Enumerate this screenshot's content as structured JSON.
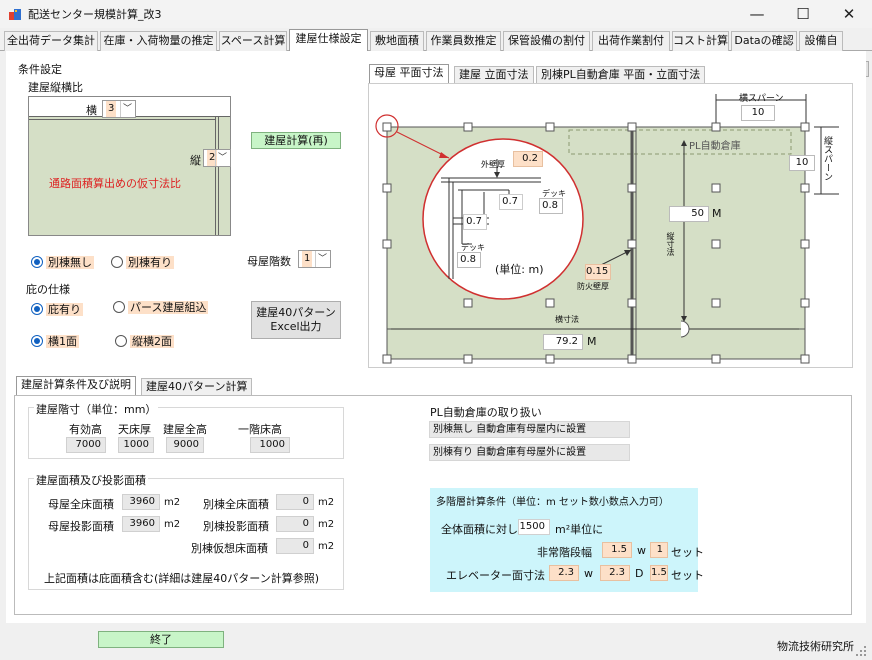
{
  "window": {
    "title": "配送センター規模計算_改3",
    "minimize": "—",
    "maximize": "☐",
    "close": "✕"
  },
  "main_tabs": [
    "全出荷データ集計",
    "在庫・入荷物量の推定",
    "スペース計算",
    "建屋仕様設定",
    "敷地面積",
    "作業員数推定",
    "保管設備の割付",
    "出荷作業割付",
    "コスト計算",
    "Dataの確認",
    "設備自"
  ],
  "main_tab_scroll": {
    "left": "◂",
    "right": "▸"
  },
  "conditions": {
    "title": "条件設定",
    "aspect_label": "建屋縦横比",
    "yoko_label": "横",
    "yoko_value": "3",
    "tate_label": "縦",
    "tate_value": "2",
    "placeholder_text": "通路面積算出めの仮寸法比",
    "calc_button": "建屋計算(再)",
    "radio_betsumune_none": "別棟無し",
    "radio_betsumune_yes": "別棟有り",
    "floors_label": "母屋階数",
    "floors_value": "1",
    "eave_title": "庇の仕様",
    "radio_eave_yes": "庇有り",
    "radio_perth": "パース建屋組込",
    "radio_side1": "横1面",
    "radio_side2": "縦横2面",
    "excel_button_line1": "建屋40パターン",
    "excel_button_line2": "Excel出力"
  },
  "drawing_tabs": [
    "母屋 平面寸法",
    "建屋 立面寸法",
    "別棟PL自動倉庫 平面・立面寸法"
  ],
  "drawing": {
    "yoko_span_label": "横スパーン",
    "yoko_span_value": "10",
    "tate_span_label": "縦スパーン",
    "tate_span_value": "10",
    "pl_label": "PL自動倉庫",
    "tate_sun_label": "縦寸法",
    "tate_sun_value": "50",
    "yoko_sun_label": "横寸法",
    "yoko_sun_value": "79.2",
    "unit_m": "M",
    "outer_wall_label": "外壁厚",
    "outer_wall_value": "0.2",
    "deck_label": "デッキ",
    "deck_value_1": "0.8",
    "dim_07a": "0.7",
    "dim_07b": "0.7",
    "deck_value_2": "0.8",
    "unit_note": "(単位: m)",
    "fire_wall_value": "0.15",
    "fire_wall_label": "防火壁厚"
  },
  "bottom_tabs": [
    "建屋計算条件及び説明",
    "建屋40パターン計算"
  ],
  "height": {
    "title": "建屋階寸（単位：mm）",
    "headers": [
      "有効高",
      "天床厚",
      "建屋全高",
      "一階床高"
    ],
    "values": [
      "7000",
      "1000",
      "9000",
      "1000"
    ]
  },
  "area": {
    "title": "建屋面積及び投影面積",
    "rows": [
      {
        "label": "母屋全床面積",
        "value": "3960",
        "unit": "m2"
      },
      {
        "label": "母屋投影面積",
        "value": "3960",
        "unit": "m2"
      }
    ],
    "right_rows": [
      {
        "label": "別棟全床面積",
        "value": "0",
        "unit": "m2"
      },
      {
        "label": "別棟投影面積",
        "value": "0",
        "unit": "m2"
      },
      {
        "label": "別棟仮想床面積",
        "value": "0",
        "unit": "m2"
      }
    ],
    "note": "上記面積は庇面積含む(詳細は建屋40パターン計算参照)"
  },
  "pl": {
    "title": "PL自動倉庫の取り扱い",
    "line1": "別棟無し 自動倉庫有母屋内に設置",
    "line2": "別棟有り 自動倉庫有母屋外に設置"
  },
  "multi": {
    "title": "多階層計算条件（単位：m セット数小数点入力可）",
    "area_prefix": "全体面積に対し",
    "area_value": "1500",
    "area_suffix": "m²単位に",
    "stair_label": "非常階段幅",
    "stair_w": "1.5",
    "w_unit": "w",
    "stair_set": "1",
    "set_unit": "セット",
    "elev_label": "エレベーター面寸法",
    "elev_w": "2.3",
    "d_unit": "D",
    "elev_d": "2.3",
    "elev_set": "1.5"
  },
  "footer": {
    "close_button": "終了",
    "company": "物流技術研究所"
  },
  "colors": {
    "accent": "#1060c0",
    "plan_fill": "#d5dfc6",
    "sky": "#cdf5fb",
    "orange_field": "#fde0c8",
    "green_button": "#c8f5c8",
    "red_text": "#dd2222"
  }
}
